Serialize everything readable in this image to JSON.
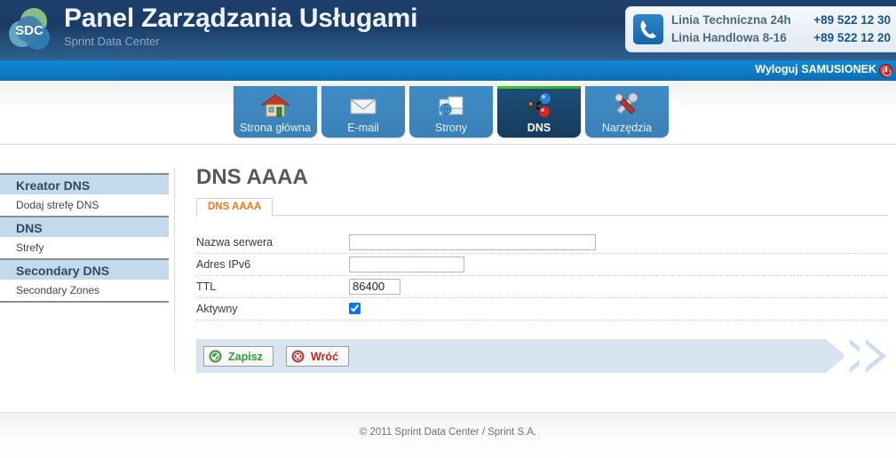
{
  "header": {
    "logo_text": "SDC",
    "logo_icon": "sdc-circles-logo",
    "title": "Panel Zarządzania Usługami",
    "subtitle": "Sprint Data Center",
    "contact": {
      "phone_icon": "phone-icon",
      "rows": [
        {
          "label": "Linia Techniczna 24h",
          "number": "+89 522 12 30"
        },
        {
          "label": "Linia Handlowa 8-16",
          "number": "+89 522 12 20"
        }
      ]
    },
    "logout": {
      "label": "Wyloguj SAMUSIONEK",
      "icon": "power-icon"
    }
  },
  "nav": {
    "tabs": [
      {
        "label": "Strona główna",
        "icon": "house-icon",
        "active": false
      },
      {
        "label": "E-mail",
        "icon": "envelope-icon",
        "active": false
      },
      {
        "label": "Strony",
        "icon": "folder-globe-icon",
        "active": false
      },
      {
        "label": "DNS",
        "icon": "molecule-icon",
        "active": true
      },
      {
        "label": "Narzędzia",
        "icon": "wrench-screwdriver-icon",
        "active": false
      }
    ]
  },
  "sidebar": {
    "groups": [
      {
        "title": "Kreator DNS",
        "items": [
          {
            "label": "Dodaj strefę DNS"
          }
        ]
      },
      {
        "title": "DNS",
        "items": [
          {
            "label": "Strefy"
          }
        ]
      },
      {
        "title": "Secondary DNS",
        "items": [
          {
            "label": "Secondary Zones"
          }
        ]
      }
    ]
  },
  "main": {
    "page_title": "DNS AAAA",
    "subtabs": [
      {
        "label": "DNS AAAA",
        "active": true
      }
    ],
    "form": {
      "rows": [
        {
          "label": "Nazwa serwera",
          "type": "text",
          "value": "",
          "placeholder": "",
          "size": "wide"
        },
        {
          "label": "Adres IPv6",
          "type": "text",
          "value": "",
          "placeholder": "",
          "size": "mid"
        },
        {
          "label": "TTL",
          "type": "text",
          "value": "86400",
          "placeholder": "",
          "size": "small"
        },
        {
          "label": "Aktywny",
          "type": "checkbox",
          "checked": true
        }
      ]
    },
    "buttons": [
      {
        "label": "Zapisz",
        "icon": "green-check-icon"
      },
      {
        "label": "Wróć",
        "icon": "red-cross-icon"
      }
    ]
  },
  "footer": {
    "text": "© 2011 Sprint Data Center / Sprint S.A."
  },
  "colors": {
    "header_dark_blue": "#1e4270",
    "logout_bar_blue": "#0f7cc6",
    "tab_blue": "#3d86be",
    "tab_active_blue": "#194468",
    "tab_active_accent_green": "#3fc82a",
    "sidebar_group_blue": "#c3d9ec",
    "subtab_orange": "#ef7817",
    "buttonbar_blue": "#d9e4f1",
    "save_green": "#2f9e2f",
    "back_red": "#cc2222"
  }
}
